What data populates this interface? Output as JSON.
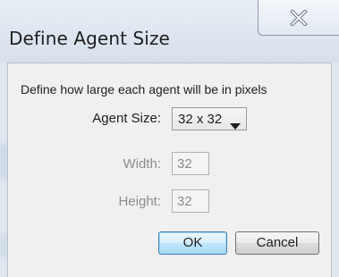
{
  "window": {
    "title": "Define Agent Size",
    "close_icon": "close-icon"
  },
  "dialog": {
    "description": "Define how large each agent will be in pixels",
    "agent_size": {
      "label": "Agent Size:",
      "selected": "32 x 32",
      "dropdown_icon": "chevron-down-icon"
    },
    "width": {
      "label": "Width:",
      "value": "32",
      "enabled": false
    },
    "height": {
      "label": "Height:",
      "value": "32",
      "enabled": false
    },
    "ok_label": "OK",
    "cancel_label": "Cancel"
  },
  "colors": {
    "disabled_text": "#8d8d8d",
    "dialog_background": "#f0f0f0",
    "default_button_border": "#3c7fb1"
  }
}
